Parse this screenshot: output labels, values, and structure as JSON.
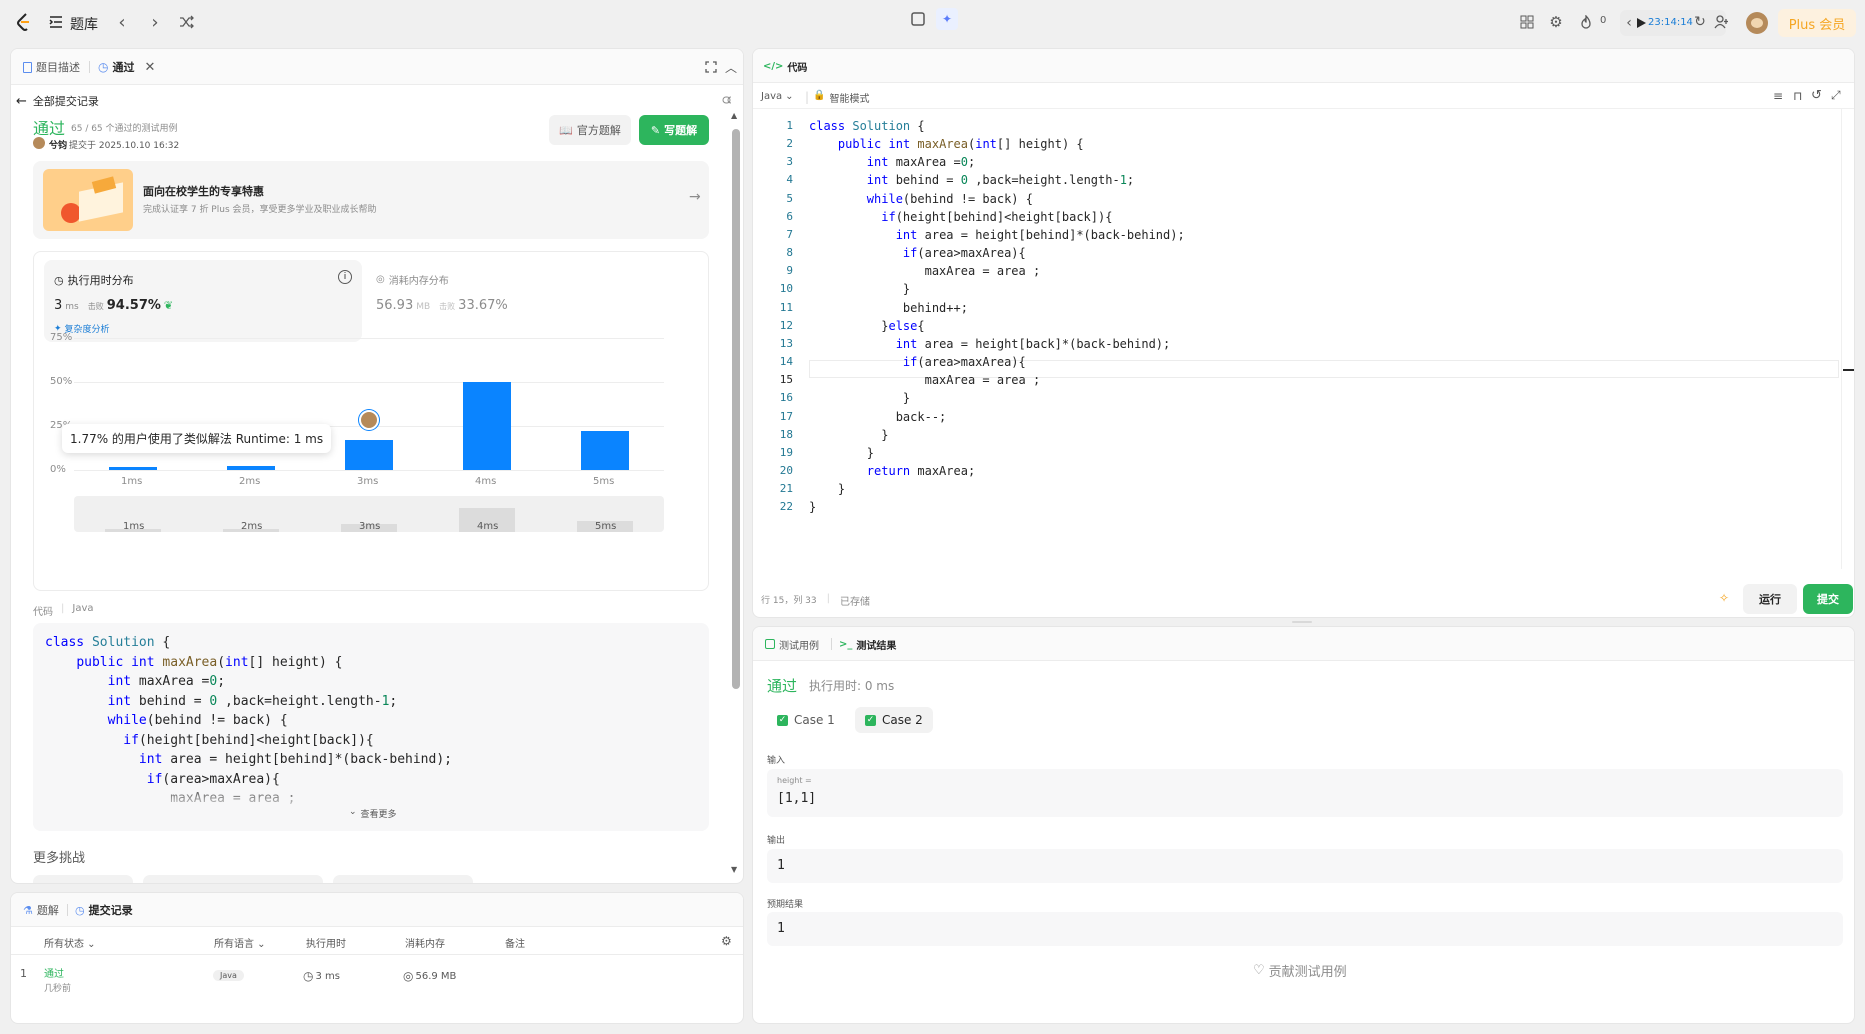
{
  "topbar": {
    "title": "题库",
    "timer": "23:14:14",
    "streak": "0",
    "plus": "Plus 会员"
  },
  "left_panel": {
    "tabs": [
      {
        "label": "题目描述"
      },
      {
        "label": "通过"
      }
    ],
    "back_link": "全部提交记录",
    "status": "通过",
    "tests_passed": "65 / 65 个通过的测试用例",
    "user": "兮钧",
    "submitted_at": "提交于 2025.10.10 16:32",
    "official_solution": "官方题解",
    "write_solution": "写题解",
    "promo": {
      "title": "面向在校学生的专享特惠",
      "subtitle": "完成认证享 7 折 Plus 会员，享受更多学业及职业成长帮助"
    },
    "runtime": {
      "label": "执行用时分布",
      "value": "3",
      "unit": "ms",
      "beats_label": "击败",
      "beats": "94.57%",
      "analysis": "复杂度分析"
    },
    "memory": {
      "label": "消耗内存分布",
      "value": "56.93",
      "unit": "MB",
      "beats_label": "击败",
      "beats": "33.67%"
    },
    "tooltip": "1.77% 的用户使用了类似解法 Runtime: 1 ms",
    "code_label": "代码",
    "code_lang": "Java",
    "see_more": "查看更多",
    "more_challenges": "更多挑战"
  },
  "chart_data": {
    "type": "bar",
    "categories": [
      "1ms",
      "2ms",
      "3ms",
      "4ms",
      "5ms"
    ],
    "values": [
      1.77,
      2.5,
      17,
      50,
      22
    ],
    "yticks": [
      "0%",
      "25%",
      "50%",
      "75%"
    ],
    "ylim": [
      0,
      75
    ],
    "highlight_category": "3ms"
  },
  "left_code_lines": [
    "class Solution {",
    "    public int maxArea(int[] height) {",
    "        int maxArea =0;",
    "        int behind = 0 ,back=height.length-1;",
    "        while(behind != back) {",
    "          if(height[behind]<height[back]){",
    "            int area = height[behind]*(back-behind);",
    "             if(area>maxArea){",
    "                maxArea = area ;"
  ],
  "bottom_panel": {
    "tabs": [
      {
        "label": "题解"
      },
      {
        "label": "提交记录"
      }
    ],
    "columns": [
      "所有状态",
      "所有语言",
      "执行用时",
      "消耗内存",
      "备注"
    ],
    "rows": [
      {
        "index": "1",
        "status": "通过",
        "time_ago": "几秒前",
        "language": "Java",
        "runtime": "3 ms",
        "memory": "56.9 MB"
      }
    ]
  },
  "editor": {
    "title": "代码",
    "language": "Java",
    "mode": "智能模式",
    "cursor_pos": "行 15，列 33",
    "saved": "已存储",
    "run": "运行",
    "submit": "提交",
    "lines": [
      "class Solution {",
      "    public int maxArea(int[] height) {",
      "        int maxArea =0;",
      "        int behind = 0 ,back=height.length-1;",
      "        while(behind != back) {",
      "          if(height[behind]<height[back]){",
      "            int area = height[behind]*(back-behind);",
      "             if(area>maxArea){",
      "                maxArea = area ;",
      "             }",
      "             behind++;",
      "          }else{",
      "            int area = height[back]*(back-behind);",
      "             if(area>maxArea){",
      "                maxArea = area ;",
      "             }",
      "            back--;",
      "          }",
      "        }",
      "        return maxArea;",
      "    }",
      "}"
    ]
  },
  "test_panel": {
    "tabs": [
      {
        "label": "测试用例"
      },
      {
        "label": "测试结果"
      }
    ],
    "status": "通过",
    "runtime": "执行用时: 0 ms",
    "cases": [
      "Case 1",
      "Case 2"
    ],
    "input_label": "输入",
    "param_name": "height =",
    "input_value": "[1,1]",
    "output_label": "输出",
    "output_value": "1",
    "expected_label": "预期结果",
    "expected_value": "1",
    "contribute": "贡献测试用例"
  }
}
